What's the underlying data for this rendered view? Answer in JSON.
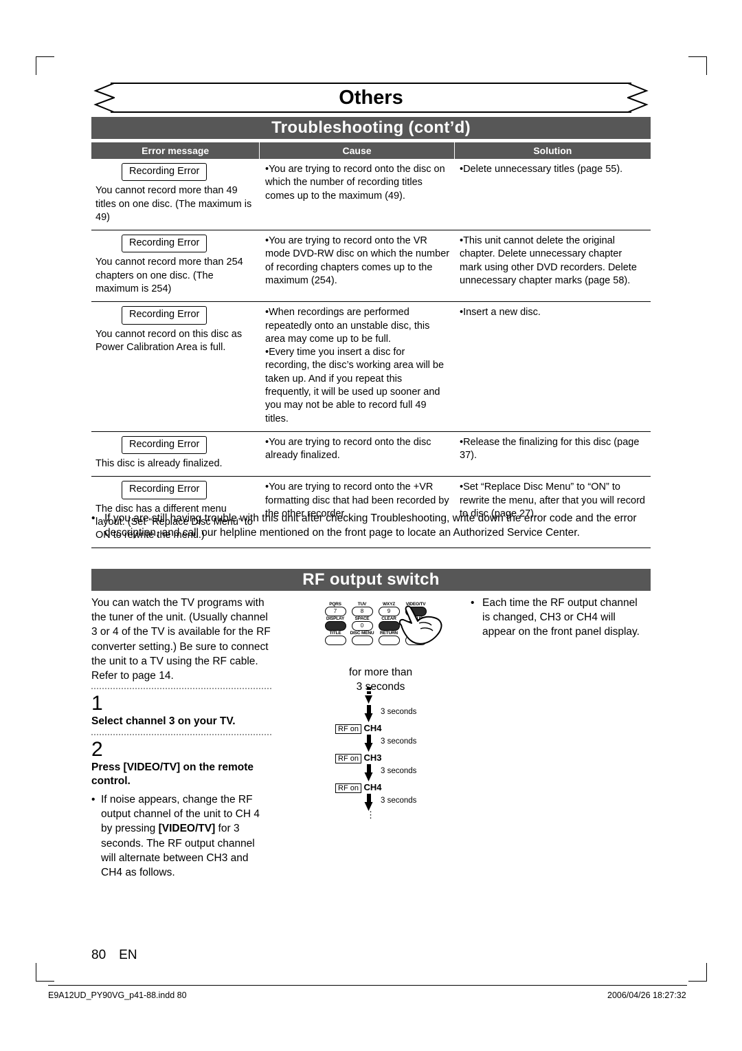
{
  "page": {
    "banner_title": "Others",
    "section_troubleshooting": "Troubleshooting (cont’d)",
    "section_rf": "RF output switch",
    "page_number": "80",
    "page_lang": "EN",
    "footer_left": "E9A12UD_PY90VG_p41-88.indd   80",
    "footer_right": "2006/04/26   18:27:32"
  },
  "table": {
    "headers": [
      "Error message",
      "Cause",
      "Solution"
    ],
    "rows": [
      {
        "badge": "Recording Error",
        "message": "You cannot record more than 49 titles on one disc. (The maximum is 49)",
        "cause": "•You are trying to record onto the disc on which the number of recording titles comes up to the maximum (49).",
        "solution": "•Delete unnecessary titles (page 55)."
      },
      {
        "badge": "Recording Error",
        "message": "You cannot record more than 254 chapters on one disc. (The maximum is 254)",
        "cause": "•You are trying to record onto the VR mode DVD-RW disc on which the number of recording chapters comes up to the maximum (254).",
        "solution": "•This unit cannot delete the original chapter. Delete unnecessary chapter mark using other DVD recorders. Delete unnecessary chapter marks (page 58)."
      },
      {
        "badge": "Recording Error",
        "message": "You cannot record on this disc as Power Calibration Area is full.",
        "cause": "•When recordings are performed repeatedly onto an unstable disc, this area may come up to be full.\n•Every time you insert a disc for recording, the disc’s working area will be taken up. And if you repeat this frequently, it will be used up sooner and you may not be able to record full 49 titles.",
        "solution": "•Insert a new disc."
      },
      {
        "badge": "Recording Error",
        "message": "This disc is already finalized.",
        "cause": "•You are trying to record onto the disc already finalized.",
        "solution": "•Release the finalizing for this disc (page 37)."
      },
      {
        "badge": "Recording Error",
        "message": "The disc has a different menu layout. (Set “Replace Disc Menu” to ON to rewrite the menu.)",
        "cause": "•You are trying to record onto the +VR formatting disc that had been recorded by the other recorder.",
        "solution": "•Set “Replace Disc Menu” to “ON” to rewrite the menu, after that you will record to disc (page 27)."
      }
    ]
  },
  "note": {
    "bullet": "•",
    "text": "If you are still having trouble with this unit after checking Troubleshooting, write down the error code and the error description, and call our helpline mentioned on the front page to locate an Authorized Service Center."
  },
  "rf": {
    "intro": "You can watch the TV programs with the tuner of the unit. (Usually channel 3 or 4 of the TV is available for the RF converter setting.) Be sure to connect the unit to a TV using the RF cable. Refer to page 14.",
    "step1_num": "1",
    "step1_text": "Select channel 3 on your TV.",
    "step2_num": "2",
    "step2_text": "Press [VIDEO/TV] on the remote control.",
    "note_bullet": "•",
    "note_text_a": "If noise appears, change the RF output channel of the unit to CH 4 by pressing ",
    "note_kbd": "[VIDEO/TV]",
    "note_text_b": " for 3 seconds. The RF output channel will alternate between CH3 and CH4 as follows.",
    "for_more_than": "for more than",
    "seconds_3": "3 seconds",
    "right_bullet": "•",
    "right_text": "Each time the RF output channel is changed, CH3 or CH4 will appear on the front panel display."
  },
  "remote": {
    "keys": [
      [
        {
          "label": "PQRS",
          "btn": "7",
          "style": "light"
        },
        {
          "label": "TUV",
          "btn": "8",
          "style": "light"
        },
        {
          "label": "WXYZ",
          "btn": "9",
          "style": "light"
        },
        {
          "label": "VIDEO/TV",
          "btn": "",
          "style": "dark"
        }
      ],
      [
        {
          "label": "DISPLAY",
          "btn": "",
          "style": "dark"
        },
        {
          "label": "SPACE",
          "btn": "0",
          "style": "light"
        },
        {
          "label": "CLEAR",
          "btn": "",
          "style": "light"
        },
        {
          "label": "SETUP",
          "btn": "",
          "style": "light"
        }
      ],
      [
        {
          "label": "TITLE",
          "btn": "",
          "style": "light"
        },
        {
          "label": "DISC MENU",
          "btn": "",
          "style": "light"
        },
        {
          "label": "RETURN",
          "btn": "",
          "style": "light"
        },
        {
          "label": "OK",
          "btn": "",
          "style": "light"
        }
      ]
    ],
    "hand_icon": "pointing-hand-icon"
  },
  "sequence": [
    {
      "delay": "3 seconds",
      "rf_on": "RF on",
      "channel": "CH4"
    },
    {
      "delay": "3 seconds",
      "rf_on": "RF on",
      "channel": "CH3"
    },
    {
      "delay": "3 seconds",
      "rf_on": "RF on",
      "channel": "CH4"
    },
    {
      "delay": "3 seconds",
      "rf_on": "",
      "channel": ""
    }
  ],
  "colors": {
    "header_bar": "#575757",
    "header_text": "#ffffff",
    "text": "#000000",
    "dotted_rule": "#9a9a9a"
  }
}
